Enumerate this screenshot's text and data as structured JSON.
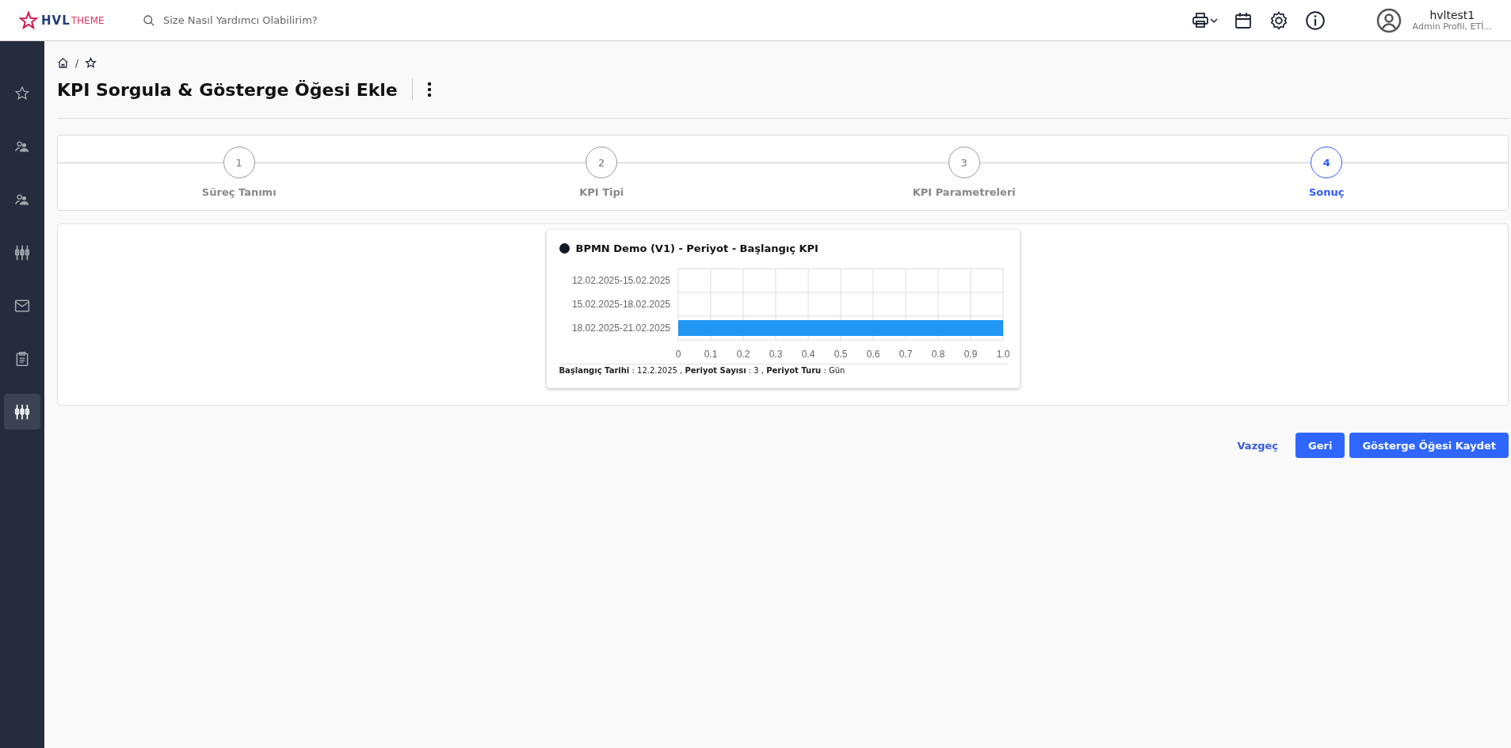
{
  "header": {
    "logo": {
      "brand": "HVL",
      "suffix": "THEME"
    },
    "search": {
      "placeholder": "Size Nasıl Yardımcı Olabilirim?"
    },
    "user": {
      "name": "hvltest1",
      "role": "Admin Profil, ETİ..."
    }
  },
  "sidebar": {
    "items": [
      {
        "kind": "star",
        "selected": false
      },
      {
        "kind": "users",
        "selected": false
      },
      {
        "kind": "users",
        "selected": false
      },
      {
        "kind": "sliders",
        "selected": false
      },
      {
        "kind": "mail",
        "selected": false
      },
      {
        "kind": "clipboard",
        "selected": false
      },
      {
        "kind": "sliders",
        "selected": true
      }
    ]
  },
  "breadcrumb": {
    "separator": "/"
  },
  "page_title": "KPI Sorgula & Gösterge Öğesi Ekle",
  "stepper": [
    {
      "number": "1",
      "label": "Süreç Tanımı",
      "selected": false
    },
    {
      "number": "2",
      "label": "KPI Tipi",
      "selected": false
    },
    {
      "number": "3",
      "label": "KPI Parametreleri",
      "selected": false
    },
    {
      "number": "4",
      "label": "Sonuç",
      "selected": true
    }
  ],
  "kpi_card": {
    "title": "BPMN Demo (V1) - Periyot - Başlangıç KPI",
    "chart_data": {
      "type": "bar",
      "orientation": "horizontal",
      "categories": [
        "12.02.2025-15.02.2025",
        "15.02.2025-18.02.2025",
        "18.02.2025-21.02.2025"
      ],
      "series": [
        {
          "color": "#2196f3",
          "values": [
            0,
            0,
            1
          ]
        }
      ],
      "grid": true,
      "xlim": [
        0,
        1
      ],
      "xticks": [
        0,
        0.1,
        0.2,
        0.3,
        0.4,
        0.5,
        0.6,
        0.7,
        0.8,
        0.9,
        {
          "value": 1,
          "label": "1.0"
        }
      ]
    },
    "footer": "**Başlangıç Tarihi** : 12.2.2025 , **Periyot Sayısı** : 3 , **Periyot Turu** : Gün"
  },
  "buttons": {
    "cancel": "Vazgeç",
    "back": "Geri",
    "save": "Gösterge Öğesi Kaydet"
  }
}
